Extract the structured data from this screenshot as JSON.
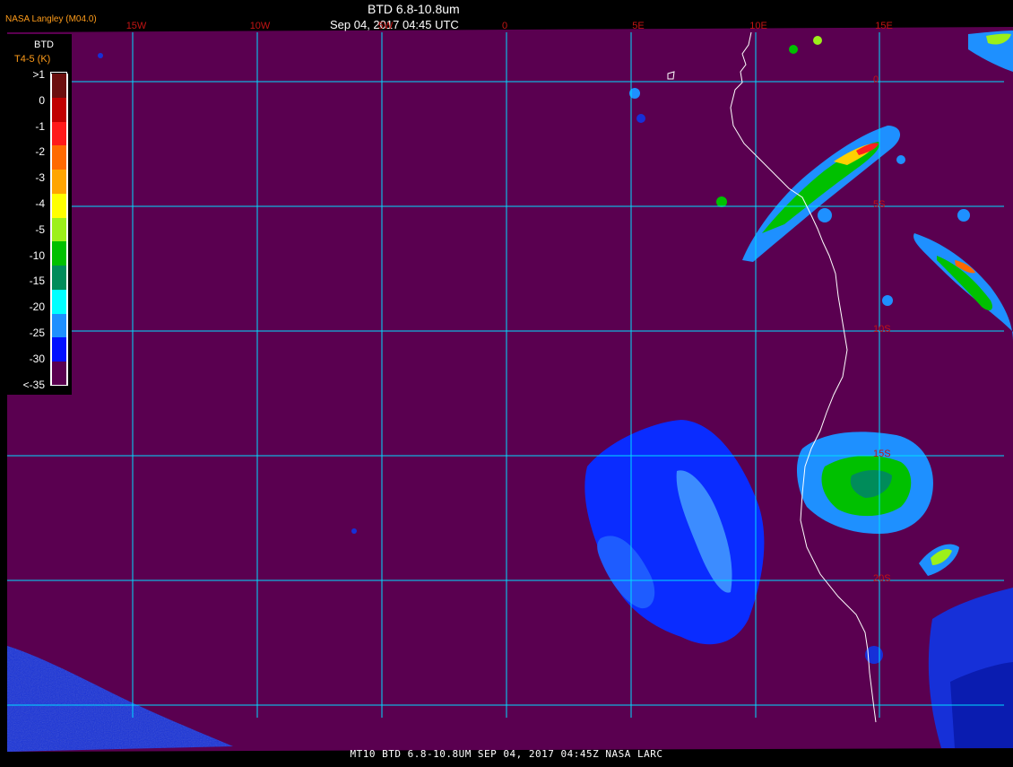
{
  "header": {
    "title": "BTD 6.8-10.8um",
    "datetime": "Sep 04, 2017 04:45 UTC",
    "organization": "NASA Langley (M04.0)"
  },
  "footer": {
    "text": "MT10  BTD 6.8-10.8UM  SEP 04, 2017 04:45Z  NASA LARC"
  },
  "grid": {
    "longitude_labels": [
      "15W",
      "10W",
      "5W",
      "0",
      "5E",
      "10E",
      "15E"
    ],
    "latitude_labels": [
      "0",
      "5S",
      "10S",
      "15S",
      "20S"
    ]
  },
  "legend": {
    "title": "BTD",
    "subtitle": "T4-5 (K)",
    "ticks": [
      ">1",
      "0",
      "-1",
      "-2",
      "-3",
      "-4",
      "-5",
      "-10",
      "-15",
      "-20",
      "-25",
      "-30",
      "<-35"
    ],
    "colors": [
      "#6b0f0f",
      "#c00000",
      "#ff1a1a",
      "#ff6a00",
      "#ffa500",
      "#ffff00",
      "#9cf01a",
      "#00c000",
      "#008c5a",
      "#00ffff",
      "#1e90ff",
      "#0010ff",
      "#5a0050"
    ]
  },
  "colors": {
    "background": "#5a0050",
    "grid_line": "#00dcff",
    "coastline": "#ffffff",
    "label_red": "#c31414"
  }
}
